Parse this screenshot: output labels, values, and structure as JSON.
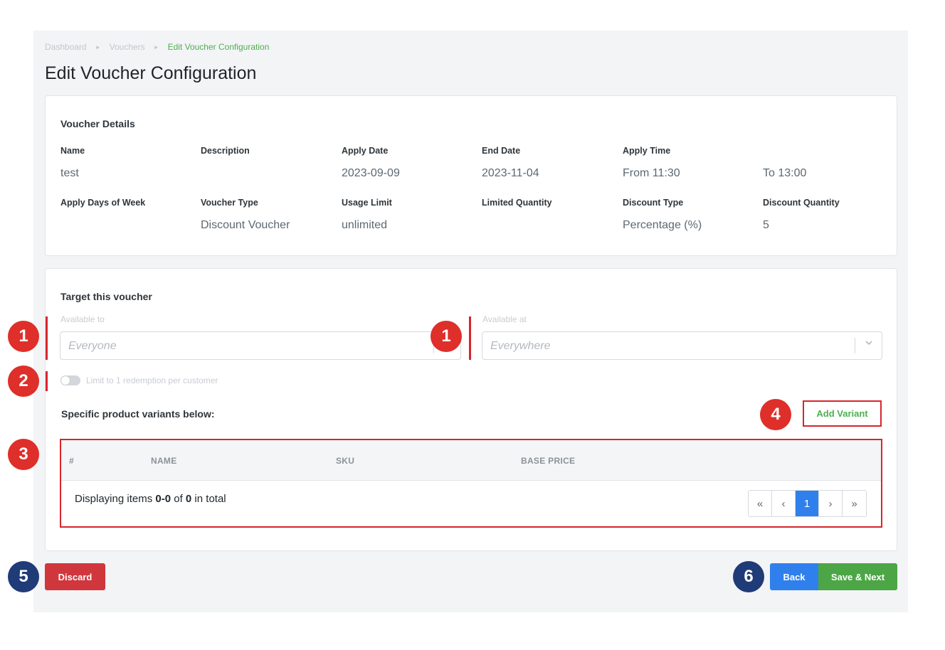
{
  "breadcrumb": {
    "items": [
      "Dashboard",
      "Vouchers",
      "Edit Voucher Configuration"
    ]
  },
  "page_title": "Edit Voucher Configuration",
  "details": {
    "title": "Voucher Details",
    "name_label": "Name",
    "name_value": "test",
    "description_label": "Description",
    "description_value": "",
    "apply_date_label": "Apply Date",
    "apply_date_value": "2023-09-09",
    "end_date_label": "End Date",
    "end_date_value": "2023-11-04",
    "apply_time_label": "Apply Time",
    "apply_time_from": "From 11:30",
    "apply_time_to": "To 13:00",
    "days_label": "Apply Days of Week",
    "days_value": "",
    "voucher_type_label": "Voucher Type",
    "voucher_type_value": "Discount Voucher",
    "usage_limit_label": "Usage Limit",
    "usage_limit_value": "unlimited",
    "limited_quantity_label": "Limited Quantity",
    "limited_quantity_value": "",
    "discount_type_label": "Discount Type",
    "discount_type_value": "Percentage (%)",
    "discount_quantity_label": "Discount Quantity",
    "discount_quantity_value": "5"
  },
  "target": {
    "title": "Target this voucher",
    "available_to_label": "Available to",
    "available_to_placeholder": "Everyone",
    "available_at_label": "Available at",
    "available_at_placeholder": "Everywhere",
    "limit_toggle_label": "Limit to 1 redemption per customer",
    "limit_toggle_on": false,
    "variants_title": "Specific product variants below:",
    "add_variant_label": "Add Variant"
  },
  "table": {
    "columns": [
      "#",
      "NAME",
      "SKU",
      "BASE PRICE"
    ],
    "rows": [],
    "footer_prefix": "Displaying items ",
    "footer_range": "0-0",
    "footer_mid": " of ",
    "footer_total": "0",
    "footer_suffix": " in total",
    "pagination": [
      "«",
      "‹",
      "1",
      "›",
      "»"
    ],
    "current_page": "1"
  },
  "buttons": {
    "discard": "Discard",
    "back": "Back",
    "save_next": "Save & Next"
  },
  "annotations": [
    "1",
    "1",
    "2",
    "3",
    "4",
    "5",
    "6"
  ],
  "colors": {
    "accent_green": "#4caf50",
    "primary_blue": "#2f80ed",
    "danger_red": "#d0373d",
    "annotation_red": "#de2f2a",
    "annotation_blue": "#1f3b78"
  }
}
